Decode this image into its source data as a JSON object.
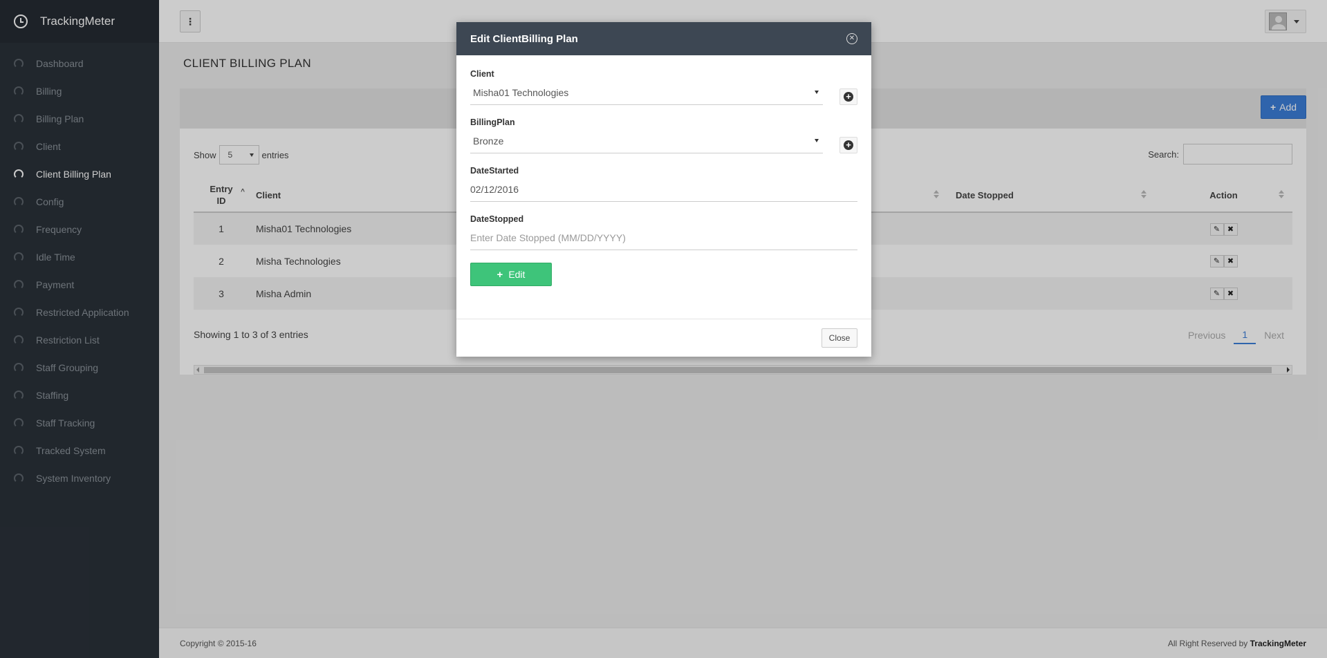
{
  "brand": {
    "name": "TrackingMeter"
  },
  "sidebar": {
    "items": [
      {
        "label": "Dashboard"
      },
      {
        "label": "Billing"
      },
      {
        "label": "Billing Plan"
      },
      {
        "label": "Client"
      },
      {
        "label": "Client Billing Plan",
        "active": true
      },
      {
        "label": "Config"
      },
      {
        "label": "Frequency"
      },
      {
        "label": "Idle Time"
      },
      {
        "label": "Payment"
      },
      {
        "label": "Restricted Application"
      },
      {
        "label": "Restriction List"
      },
      {
        "label": "Staff Grouping"
      },
      {
        "label": "Staffing"
      },
      {
        "label": "Staff Tracking"
      },
      {
        "label": "Tracked System"
      },
      {
        "label": "System Inventory"
      }
    ]
  },
  "topbar": {
    "menu_icon": "⋮"
  },
  "page": {
    "title": "CLIENT BILLING PLAN",
    "add_label": "Add"
  },
  "table": {
    "show_label": "Show",
    "entries_value": "5",
    "entries_label": "entries",
    "search_label": "Search:",
    "headers": {
      "entry_id": "Entry ID",
      "client": "Client",
      "date_stopped": "Date Stopped",
      "action": "Action"
    },
    "rows": [
      {
        "id": "1",
        "client": "Misha01 Technologies"
      },
      {
        "id": "2",
        "client": "Misha Technologies"
      },
      {
        "id": "3",
        "client": "Misha Admin"
      }
    ],
    "showing": "Showing 1 to 3 of 3 entries",
    "pager": {
      "previous": "Previous",
      "current": "1",
      "next": "Next"
    }
  },
  "footer": {
    "copyright": "Copyright © 2015-16",
    "reserved": "All Right Reserved by",
    "brand": "TrackingMeter"
  },
  "modal": {
    "title": "Edit ClientBilling Plan",
    "client_label": "Client",
    "client_value": "Misha01 Technologies",
    "plan_label": "BillingPlan",
    "plan_value": "Bronze",
    "date_started_label": "DateStarted",
    "date_started_value": "02/12/2016",
    "date_stopped_label": "DateStopped",
    "date_stopped_placeholder": "Enter Date Stopped (MM/DD/YYYY)",
    "edit_label": "Edit",
    "close_label": "Close"
  },
  "colors": {
    "sidebar": "#2a3139",
    "modal_header": "#3d4753",
    "primary": "#3b7dd8",
    "success": "#3ec47a"
  }
}
